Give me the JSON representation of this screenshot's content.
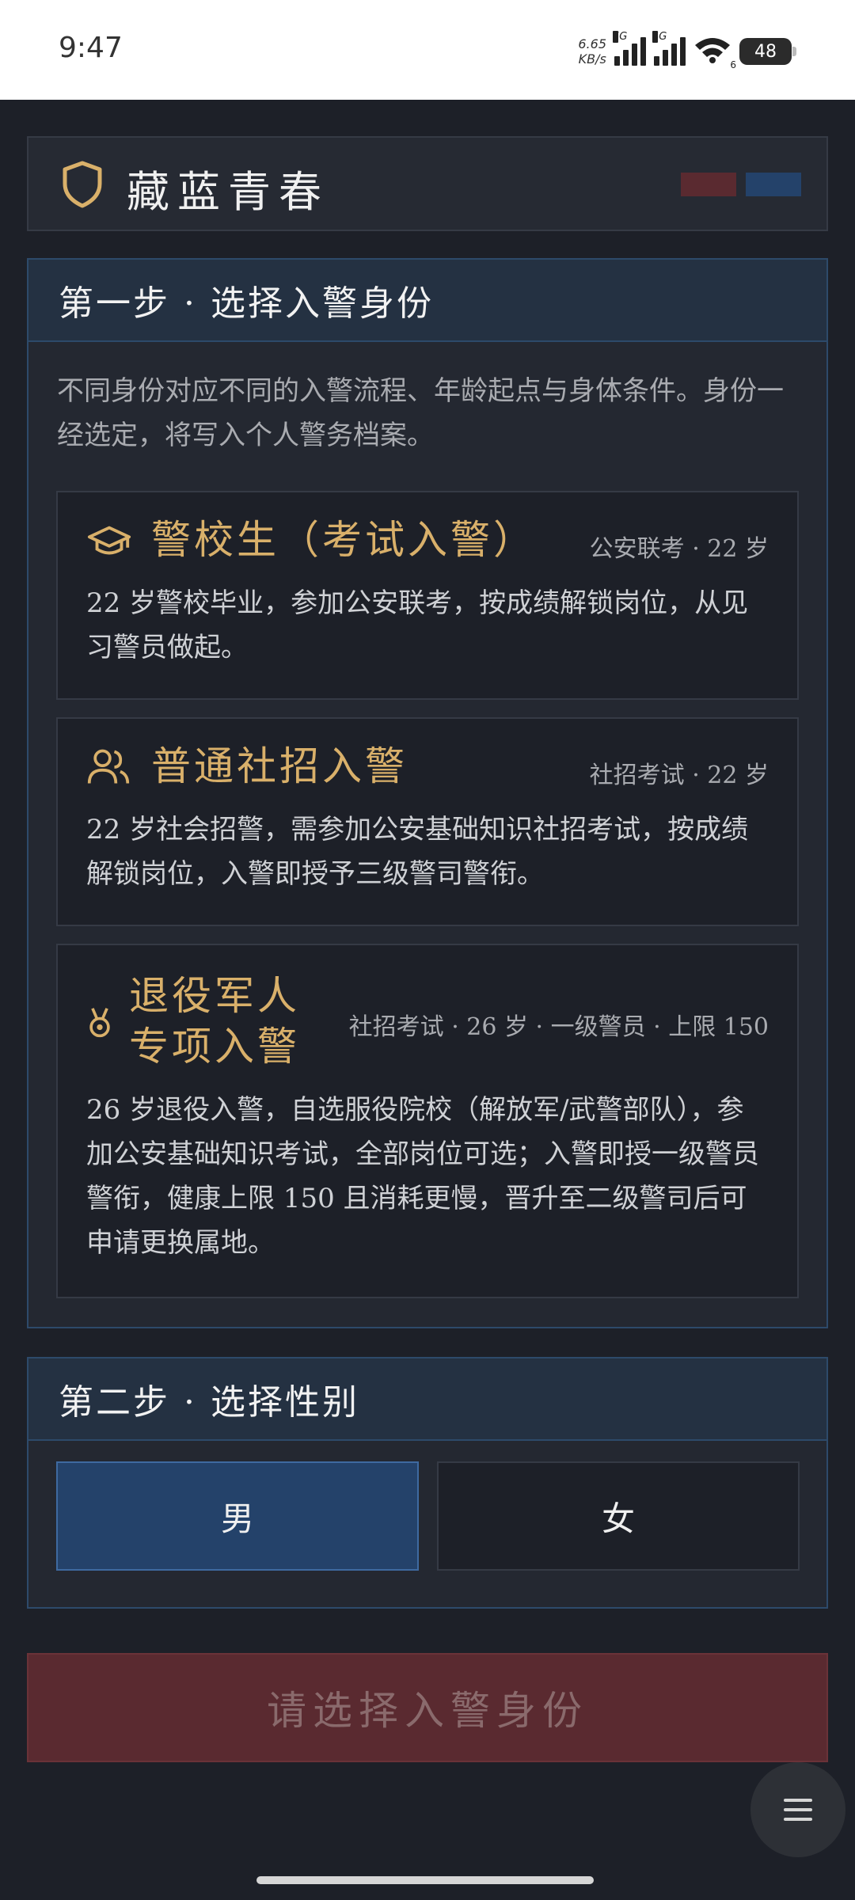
{
  "status": {
    "time": "9:47",
    "net_speed_value": "6.65",
    "net_speed_unit": "KB/s",
    "sim1_tag": "5G",
    "sim2_tag": "4G",
    "wifi_tag": "6",
    "battery": "48"
  },
  "header": {
    "title": "藏蓝青春",
    "swatch_colors": [
      "#5a2a30",
      "#24426a"
    ]
  },
  "step1": {
    "title": "第一步 · 选择入警身份",
    "description": "不同身份对应不同的入警流程、年龄起点与身体条件。身份一经选定，将写入个人警务档案。",
    "options": [
      {
        "icon": "graduation-cap-icon",
        "title": "警校生（考试入警）",
        "meta": "公安联考 · 22 岁",
        "body": "22 岁警校毕业，参加公安联考，按成绩解锁岗位，从见习警员做起。"
      },
      {
        "icon": "users-icon",
        "title": "普通社招入警",
        "meta": "社招考试 · 22 岁",
        "body": "22 岁社会招警，需参加公安基础知识社招考试，按成绩解锁岗位，入警即授予三级警司警衔。"
      },
      {
        "icon": "medal-icon",
        "title_line1": "退役军人",
        "title_line2": "专项入警",
        "meta": "社招考试 · 26 岁 · 一级警员 · 上限 150",
        "body": "26 岁退役入警，自选服役院校（解放军/武警部队），参加公安基础知识考试，全部岗位可选；入警即授一级警员警衔，健康上限 150 且消耗更慢，晋升至二级警司后可申请更换属地。"
      }
    ]
  },
  "step2": {
    "title": "第二步 · 选择性别",
    "male": "男",
    "female": "女",
    "selected": "男"
  },
  "submit_label": "请选择入警身份",
  "colors": {
    "accent_gold": "#d9b06a",
    "selected_blue": "#24426a",
    "submit_red": "#5a2a30"
  }
}
